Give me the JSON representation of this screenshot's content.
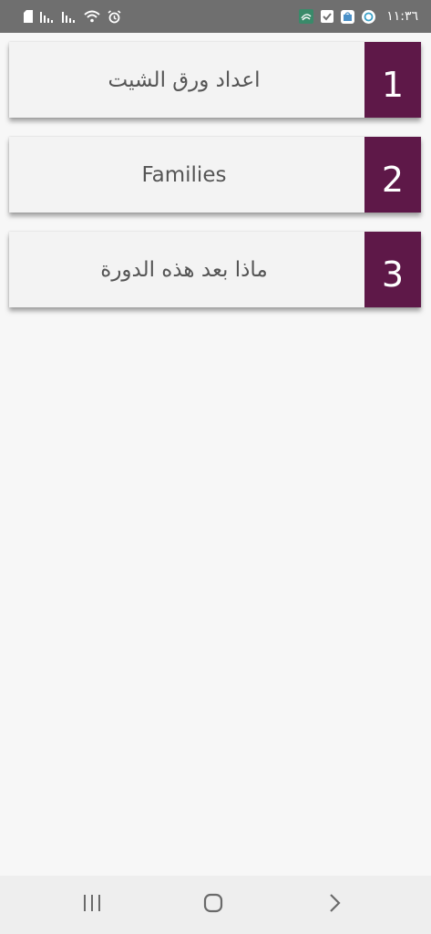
{
  "status_bar": {
    "time": "١١:٣٦",
    "left_icons": [
      "sd-card-icon",
      "signal-bars-icon",
      "signal-bars-icon",
      "wifi-icon",
      "alarm-icon"
    ],
    "right_icons": [
      "app-notification-icon",
      "checkbox-notification-icon",
      "store-notification-icon",
      "sync-notification-icon"
    ]
  },
  "menu": {
    "items": [
      {
        "number": "1",
        "title": "اعداد ورق الشيت"
      },
      {
        "number": "2",
        "title": "Families"
      },
      {
        "number": "3",
        "title": "ماذا بعد هذه الدورة"
      }
    ]
  },
  "nav_bar": {
    "buttons": [
      "recent-apps-icon",
      "home-icon",
      "back-icon"
    ]
  },
  "colors": {
    "accent": "#5e1848",
    "card_background": "#f3f3f3",
    "page_background": "#f7f7f7",
    "status_bar": "#6f6f6f",
    "nav_bar": "#eeeeee",
    "title_text": "#555555"
  }
}
